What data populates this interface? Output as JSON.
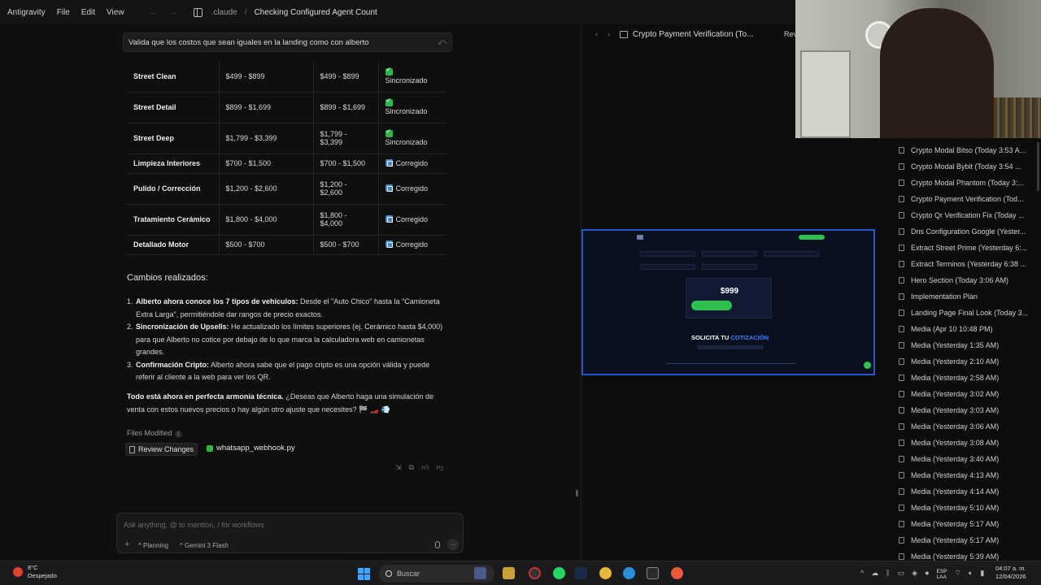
{
  "menubar": {
    "app_name": "Antigravity",
    "items": [
      "File",
      "Edit",
      "View"
    ],
    "breadcrumb_folder": ".claude",
    "breadcrumb_sep": "/",
    "title": "Checking Configured Agent Count"
  },
  "chat": {
    "user_query": "Valida que los costos que sean iguales en la landing como con alberto",
    "table_rows": [
      {
        "name": "Street Clean",
        "landing": "$499 - $899",
        "alberto": "$499 - $899",
        "status": "Sincronizado",
        "status_type": "ok"
      },
      {
        "name": "Street Detail",
        "landing": "$899 - $1,699",
        "alberto": "$899 - $1,699",
        "status": "Sincronizado",
        "status_type": "ok"
      },
      {
        "name": "Street Deep",
        "landing": "$1,799 - $3,399",
        "alberto": "$1,799 - $3,399",
        "status": "Sincronizado",
        "status_type": "ok"
      },
      {
        "name": "Limpieza Interiores",
        "landing": "$700 - $1,500",
        "alberto": "$700 - $1,500",
        "status": "Corregido",
        "status_type": "fix"
      },
      {
        "name": "Pulido / Corrección",
        "landing": "$1,200 - $2,600",
        "alberto": "$1,200 - $2,600",
        "status": "Corregido",
        "status_type": "fix"
      },
      {
        "name": "Tratamiento Cerámico",
        "landing": "$1,800 - $4,000",
        "alberto": "$1,800 - $4,000",
        "status": "Corregido",
        "status_type": "fix"
      },
      {
        "name": "Detallado Motor",
        "landing": "$500 - $700",
        "alberto": "$500 - $700",
        "status": "Corregido",
        "status_type": "fix"
      }
    ],
    "changes_title": "Cambios realizados:",
    "changes": [
      {
        "num": "1.",
        "bold": "Alberto ahora conoce los 7 tipos de vehículos:",
        "text": " Desde el \"Auto Chico\" hasta la \"Camioneta Extra Larga\", permitiéndole dar rangos de precio exactos."
      },
      {
        "num": "2.",
        "bold": "Sincronización de Upsells:",
        "text": " He actualizado los límites superiores (ej. Cerámico hasta $4,000) para que Alberto no cotice por debajo de lo que marca la calculadora web en camionetas grandes."
      },
      {
        "num": "3.",
        "bold": "Confirmación Cripto:",
        "text": " Alberto ahora sabe que el pago cripto es una opción válida y puede referir al cliente a la web para ver los QR."
      }
    ],
    "closing_bold": "Todo está ahora en perfecta armonía técnica.",
    "closing_text": " ¿Deseas que Alberto haga una simulación de venta con estos nuevos precios o hay algún otro ajuste que necesites? 🏁 🏎️ 💨",
    "files_modified_label": "Files Modified",
    "files_modified_count": "1",
    "review_changes_label": "Review Changes",
    "modified_file": "whatsapp_webhook.py",
    "composer_placeholder": "Ask anything, @ to mention, / for workflows",
    "mode_label": "Planning",
    "model_label": "Gemini 3 Flash"
  },
  "browser": {
    "tab_title": "Crypto Payment Verification (To...",
    "review_label": "Revi",
    "preview": {
      "price": "$999",
      "heading": "SOLICITA TU",
      "heading_accent": "COTIZACIÓN"
    }
  },
  "history": [
    "Crypto Modal Bitso (Today 3:53 A...",
    "Crypto Modal Bybit (Today 3:54 ...",
    "Crypto Modal Phantom (Today 3:...",
    "Crypto Payment Verification (Tod...",
    "Crypto Qr Verification Fix (Today ...",
    "Dns Configuration Google (Yester...",
    "Extract Street Prime (Yesterday 6:...",
    "Extract Terminos (Yesterday 6:38 ...",
    "Hero Section (Today 3:06 AM)",
    "Implementation Plan",
    "Landing Page Final Look (Today 3...",
    "Media (Apr 10 10:48 PM)",
    "Media (Yesterday 1:35 AM)",
    "Media (Yesterday 2:10 AM)",
    "Media (Yesterday 2:58 AM)",
    "Media (Yesterday 3:02 AM)",
    "Media (Yesterday 3:03 AM)",
    "Media (Yesterday 3:06 AM)",
    "Media (Yesterday 3:08 AM)",
    "Media (Yesterday 3:40 AM)",
    "Media (Yesterday 4:13 AM)",
    "Media (Yesterday 4:14 AM)",
    "Media (Yesterday 5:10 AM)",
    "Media (Yesterday 5:17 AM)",
    "Media (Yesterday 5:17 AM)",
    "Media (Yesterday 5:39 AM)"
  ],
  "taskbar": {
    "temperature": "8°C",
    "weather": "Despejado",
    "search_label": "Buscar",
    "lang_top": "ESP",
    "lang_bottom": "LAA",
    "time": "04:07 a. m.",
    "date": "12/04/2026"
  }
}
